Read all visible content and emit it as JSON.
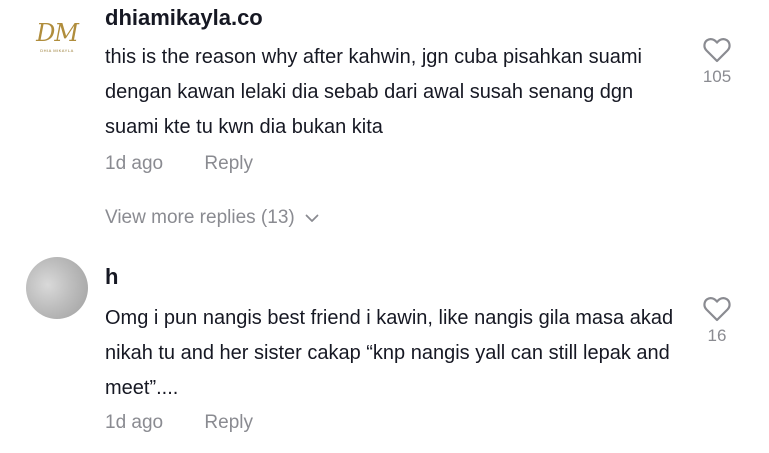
{
  "comments": [
    {
      "username": "dhiamikayla.co",
      "avatar_logo_mark": "DM",
      "avatar_logo_sub": "DHIA MIKAYLA",
      "text": "this is the reason why after kahwin, jgn cuba pisahkan suami dengan kawan lelaki dia sebab dari awal susah senang dgn suami kte tu kwn dia bukan kita",
      "time": "1d ago",
      "reply_label": "Reply",
      "likes": "105",
      "view_more_replies": "View more replies (13)"
    },
    {
      "username": "h",
      "text": "Omg i pun nangis best friend i kawin, like nangis gila masa akad nikah tu and her sister cakap “knp nangis yall can still lepak and meet”....",
      "time": "1d ago",
      "reply_label": "Reply",
      "likes": "16"
    }
  ],
  "icons": {
    "like": "heart-outline-icon",
    "expand": "chevron-down-icon"
  },
  "colors": {
    "primary_text": "#161823",
    "secondary_text": "#8a8b91",
    "logo_gold": "#b08d3c"
  }
}
